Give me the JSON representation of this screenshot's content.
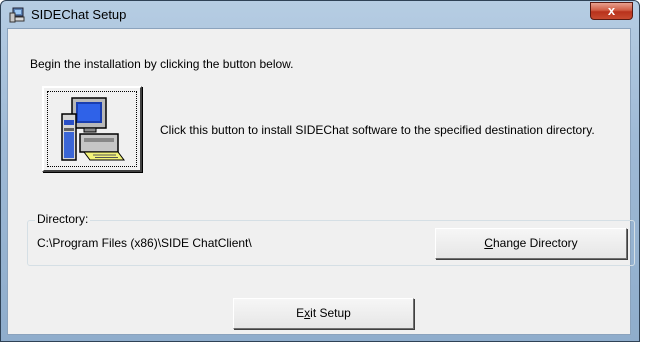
{
  "window": {
    "title": "SIDEChat Setup",
    "close_label": "x"
  },
  "intro_text": "Begin the installation by clicking the button below.",
  "install_description": "Click this button to install SIDEChat software to the specified destination directory.",
  "directory": {
    "group_label": "Directory:",
    "path": "C:\\Program Files (x86)\\SIDE ChatClient\\"
  },
  "buttons": {
    "change_directory": {
      "prefix": "",
      "mnemonic": "C",
      "rest": "hange Directory"
    },
    "exit_setup": {
      "prefix": "E",
      "mnemonic": "x",
      "rest": "it Setup"
    }
  },
  "icons": {
    "app": "setup-computer-icon",
    "install": "install-computer-icon",
    "close": "close-icon"
  }
}
